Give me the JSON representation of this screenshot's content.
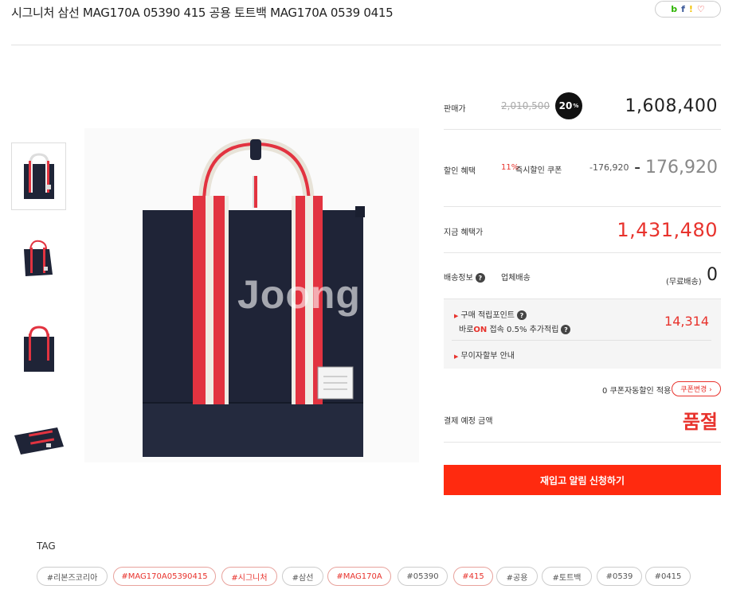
{
  "product": {
    "title": "시그니처 삼선 MAG170A 05390 415 공용 토트백 MAG170A 0539 0415",
    "watermark": "Joong"
  },
  "share": {
    "icons": [
      "blog-icon",
      "facebook-icon",
      "kakaostory-icon",
      "heart-icon"
    ],
    "blog": "b",
    "fb": "f",
    "ks": "!",
    "heart": "♡"
  },
  "price": {
    "label": "판매가",
    "original": "2,010,500",
    "discount_badge": "20",
    "discount_unit": "%",
    "sale": "1,608,400"
  },
  "discount": {
    "label": "할인 혜택",
    "rate": "11%",
    "name": "즉시할인 쿠폰",
    "amount_small": "-176,920",
    "sign": "-",
    "amount": "176,920"
  },
  "now_price": {
    "label": "지금 혜택가",
    "value": "1,431,480"
  },
  "shipping": {
    "label": "배송정보",
    "help": "?",
    "type": "업체배송",
    "free_label": "(무료배송)",
    "cost": "0"
  },
  "points": {
    "label": "구매 적립포인트",
    "help": "?",
    "extra_prefix": "바로",
    "extra_on": "ON",
    "extra_suffix": "접속 0.5% 추가적립",
    "value": "14,314",
    "installment": "무이자할부 안내",
    "arrow": "▶"
  },
  "coupon": {
    "text": "0 쿠폰자동할인 적용",
    "button": "쿠폰변경 ›"
  },
  "payment": {
    "label": "결제 예정 금액",
    "status": "품절"
  },
  "notify_button": "재입고 알림 신청하기",
  "tags": {
    "title": "TAG",
    "items": [
      {
        "label": "#리본즈코리아",
        "red": false
      },
      {
        "label": "#MAG170A05390415",
        "red": true
      },
      {
        "label": "#시그니처",
        "red": true
      },
      {
        "label": "#삼선",
        "red": false
      },
      {
        "label": "#MAG170A",
        "red": true
      },
      {
        "label": "#05390",
        "red": false
      },
      {
        "label": "#415",
        "red": true
      },
      {
        "label": "#공용",
        "red": false
      },
      {
        "label": "#토트백",
        "red": false
      },
      {
        "label": "#0539",
        "red": false
      },
      {
        "label": "#0415",
        "red": false
      }
    ]
  },
  "colors": {
    "accent": "#e8322c",
    "button": "#ff2a0f",
    "bag_navy": "#1f2437"
  }
}
